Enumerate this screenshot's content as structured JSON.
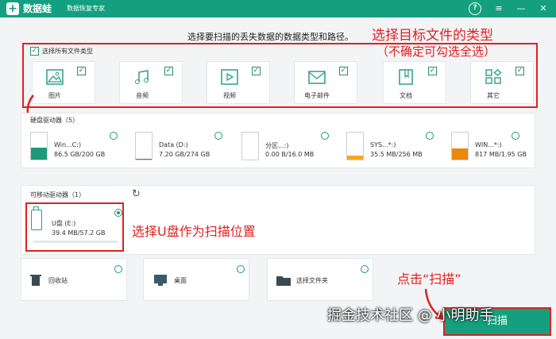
{
  "titlebar": {
    "app_name": "数据蛙",
    "app_sub": "数据恢复专家",
    "help": "?",
    "min": "—",
    "close": "✕",
    "logo": "+"
  },
  "instruction": "选择要扫描的丢失数据的数据类型和路径。",
  "annotations": {
    "select_type_title": "选择目标文件的类型",
    "select_type_note": "（不确定可勾选全选）",
    "usb_note": "选择U盘作为扫描位置",
    "click_scan": "点击“扫描”"
  },
  "file_types": {
    "all_label": "选择所有文件类型",
    "items": [
      {
        "label": "图片",
        "icon": "picture-icon",
        "checked": true
      },
      {
        "label": "音频",
        "icon": "music-note-icon",
        "checked": true
      },
      {
        "label": "视频",
        "icon": "video-icon",
        "checked": true
      },
      {
        "label": "电子邮件",
        "icon": "email-icon",
        "checked": true
      },
      {
        "label": "文档",
        "icon": "document-icon",
        "checked": true
      },
      {
        "label": "其它",
        "icon": "other-icon",
        "checked": true
      }
    ]
  },
  "hard_drives": {
    "title": "硬盘驱动器（5）",
    "items": [
      {
        "name": "Win...C:)",
        "size": "86.5 GB/200 GB",
        "used": 0.43,
        "color": "#1b9a7a"
      },
      {
        "name": "Data (D:)",
        "size": "7.20 GB/274 GB",
        "used": 0.03,
        "color": "#1b9a7a"
      },
      {
        "name": "分区...:)",
        "size": "0.00  B/16.0 MB",
        "used": 0.0,
        "color": "#1b9a7a"
      },
      {
        "name": "SYS...*:)",
        "size": "35.5 MB/256 MB",
        "used": 0.14,
        "color": "#f5a623"
      },
      {
        "name": "WIN...*:)",
        "size": "817 MB/1.95 GB",
        "used": 0.42,
        "color": "#e8890c"
      }
    ]
  },
  "removable": {
    "title": "可移动驱动器（1）",
    "refresh": "↻",
    "items": [
      {
        "name": "U盘 (E:)",
        "size": "39.4 MB/57.2 GB",
        "selected": true
      }
    ]
  },
  "locations": [
    {
      "label": "回收站",
      "icon": "recycle-bin-icon"
    },
    {
      "label": "桌面",
      "icon": "desktop-icon"
    },
    {
      "label": "选择文件夹",
      "icon": "folder-icon"
    }
  ],
  "scan_button": "扫描",
  "watermark": "掘金技术社区 @ 小明助手"
}
